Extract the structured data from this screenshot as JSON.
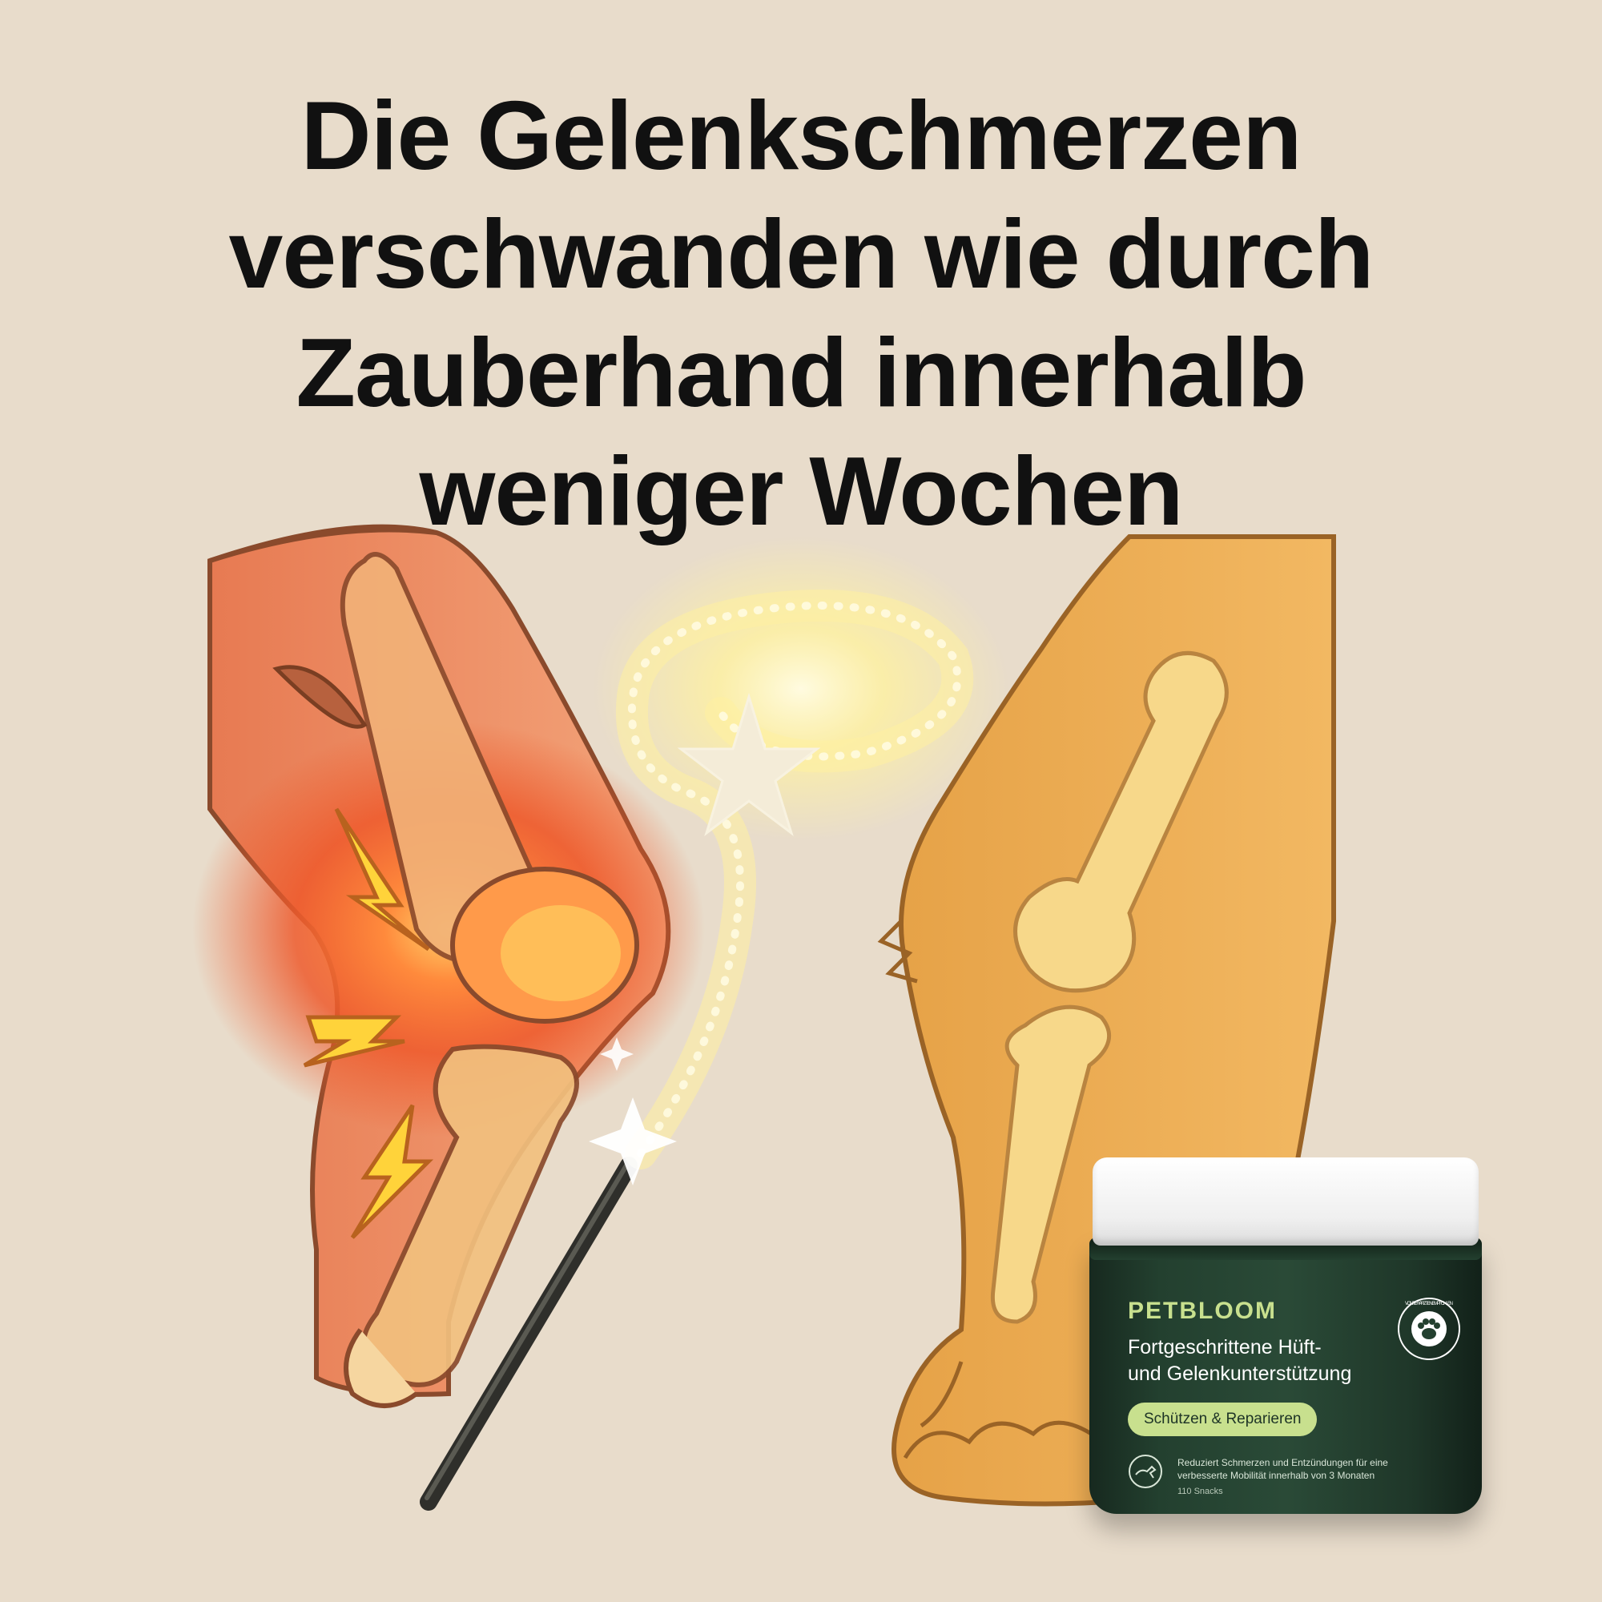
{
  "headline": {
    "line1": "Die Gelenkschmerzen",
    "line2": "verschwanden wie durch",
    "line3": "Zauberhand innerhalb",
    "line4": "weniger Wochen"
  },
  "product": {
    "brand": "PETBLOOM",
    "name_line1": "Fortgeschrittene Hüft-",
    "name_line2": "und Gelenkunterstützung",
    "tagline": "Schützen & Reparieren",
    "benefit": "Reduziert Schmerzen und Entzündungen für eine verbesserte Mobilität innerhalb von 3 Monaten",
    "count": "110 Snacks",
    "badge_text": "VON TIERÄRZTEN EMPFOHLEN",
    "icons": [
      "dog-icon",
      "paw-icon"
    ]
  },
  "colors": {
    "background": "#e8dccb",
    "headline": "#111111",
    "jar": "#23402f",
    "accent": "#c8e08e",
    "pain": "#ef5a2a",
    "healthy": "#e8a94c",
    "magic": "#fff3a6"
  },
  "illustration": {
    "left": "painful-dog-leg",
    "right": "healthy-dog-leg",
    "icons": [
      "lightning-icon",
      "star-icon",
      "magic-wand-icon",
      "sparkle-icon"
    ]
  }
}
